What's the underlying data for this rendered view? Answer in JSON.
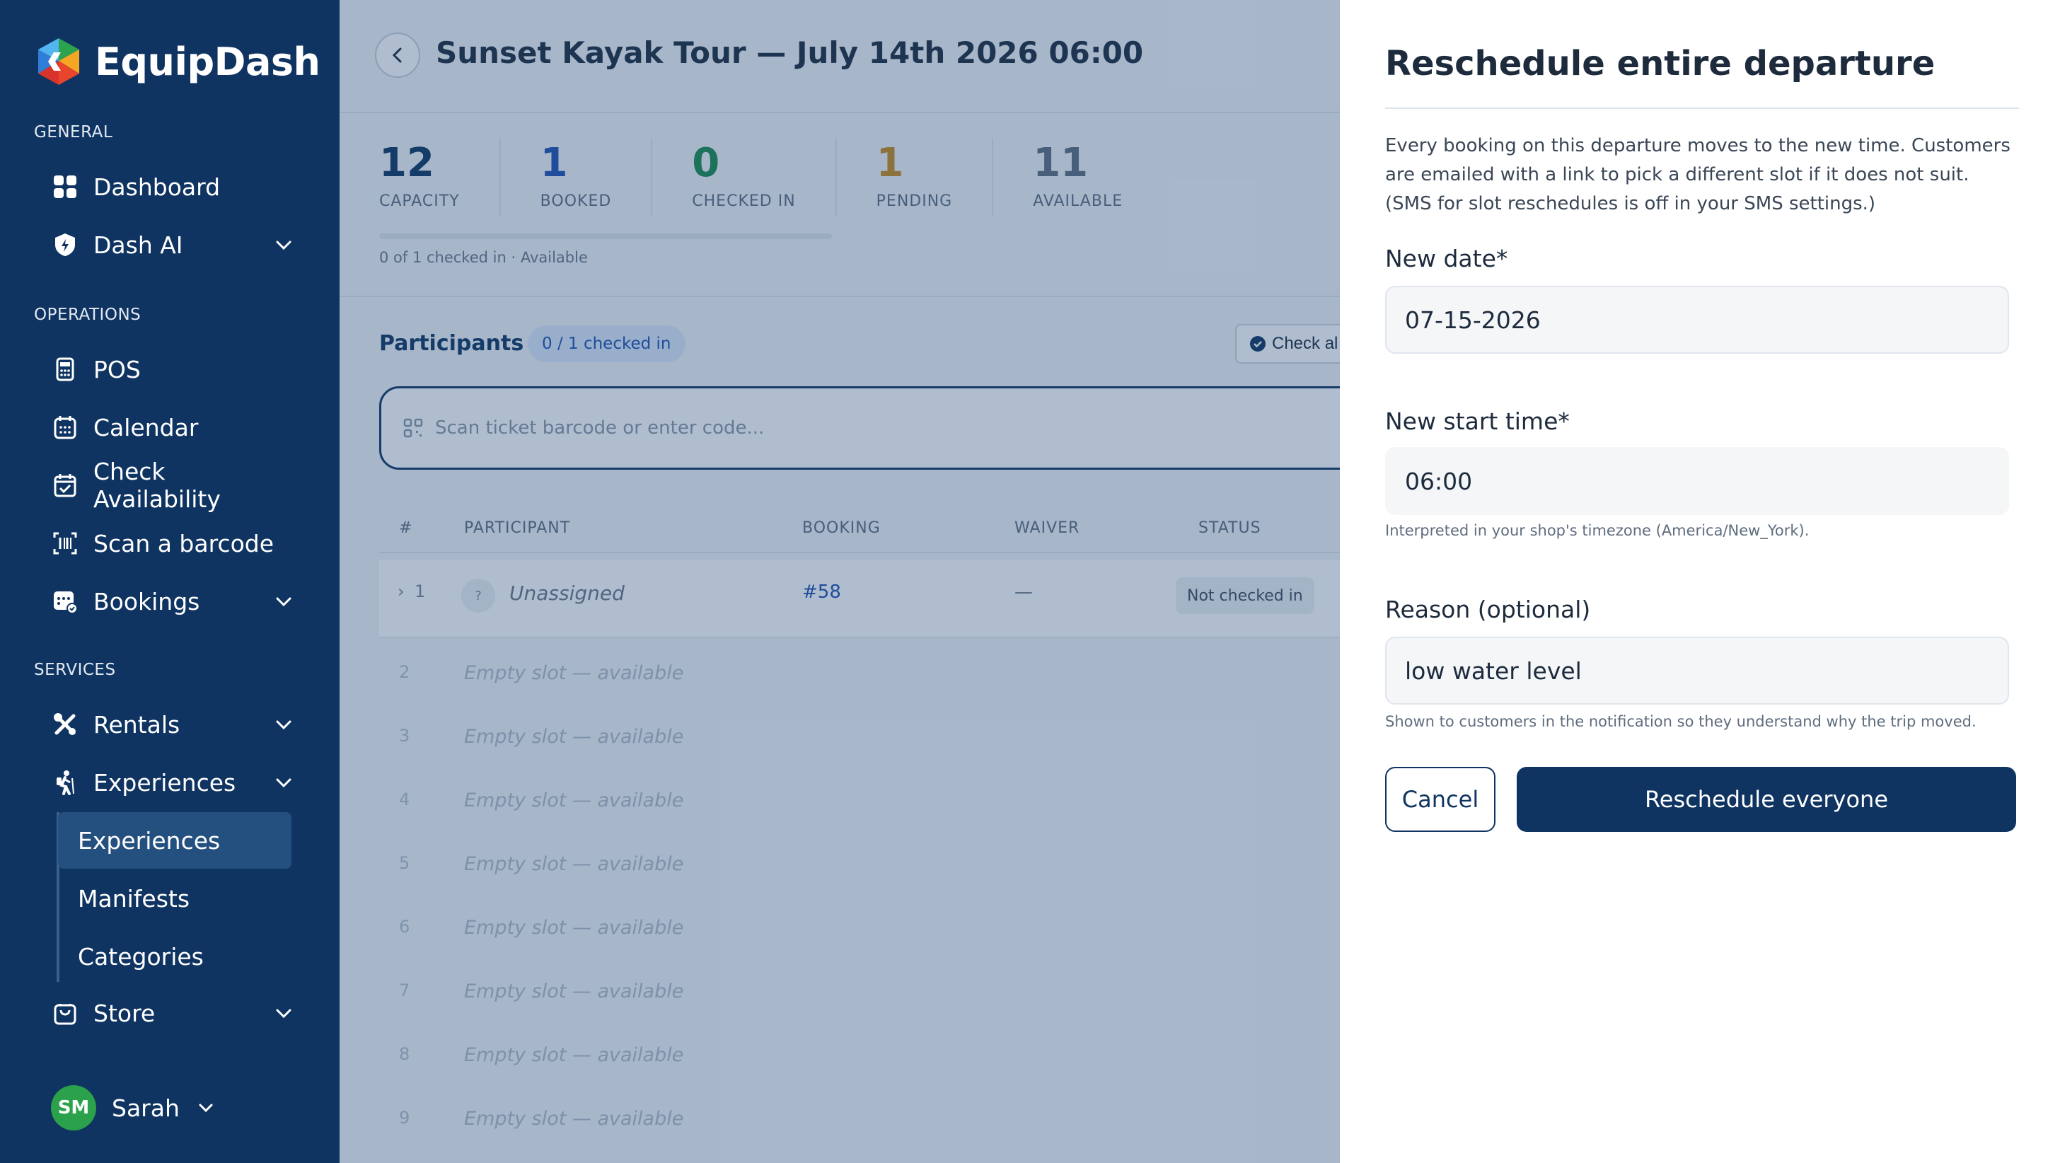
{
  "sidebar": {
    "brand": "EquipDash",
    "sections": {
      "general": "GENERAL",
      "operations": "OPERATIONS",
      "services": "SERVICES"
    },
    "items": {
      "dashboard": "Dashboard",
      "dash_ai": "Dash AI",
      "pos": "POS",
      "calendar": "Calendar",
      "check_availability": "Check Availability",
      "scan_barcode": "Scan a barcode",
      "bookings": "Bookings",
      "rentals": "Rentals",
      "experiences": "Experiences",
      "store": "Store"
    },
    "sub_items": {
      "experiences": "Experiences",
      "manifests": "Manifests",
      "categories": "Categories"
    },
    "user": {
      "initials": "SM",
      "name": "Sarah"
    }
  },
  "header": {
    "title": "Sunset Kayak Tour — July 14th 2026 06:00"
  },
  "stats": [
    {
      "value": "12",
      "label": "CAPACITY",
      "color": "#0f3461"
    },
    {
      "value": "1",
      "label": "BOOKED",
      "color": "#1f4fb0"
    },
    {
      "value": "0",
      "label": "CHECKED IN",
      "color": "#1a8a4a"
    },
    {
      "value": "1",
      "label": "PENDING",
      "color": "#c98a1d"
    },
    {
      "value": "11",
      "label": "AVAILABLE",
      "color": "#5f6d7e"
    }
  ],
  "progress": {
    "checked_fraction": 0,
    "note": "0 of 1 checked in · Available"
  },
  "participants": {
    "title": "Participants",
    "pill": "0 / 1 checked in",
    "check_all": "Check al",
    "scan_placeholder": "Scan ticket barcode or enter code..."
  },
  "table": {
    "headers": {
      "num": "#",
      "participant": "PARTICIPANT",
      "booking": "BOOKING",
      "waiver": "WAIVER",
      "status": "STATUS"
    },
    "first_row": {
      "num": "1",
      "qmark": "?",
      "participant": "Unassigned",
      "booking": "#58",
      "waiver": "—",
      "status": "Not checked in"
    },
    "empty_rows": [
      {
        "num": "2",
        "text": "Empty slot — available"
      },
      {
        "num": "3",
        "text": "Empty slot — available"
      },
      {
        "num": "4",
        "text": "Empty slot — available"
      },
      {
        "num": "5",
        "text": "Empty slot — available"
      },
      {
        "num": "6",
        "text": "Empty slot — available"
      },
      {
        "num": "7",
        "text": "Empty slot — available"
      },
      {
        "num": "8",
        "text": "Empty slot — available"
      },
      {
        "num": "9",
        "text": "Empty slot — available"
      }
    ]
  },
  "drawer": {
    "title": "Reschedule entire departure",
    "description": "Every booking on this departure moves to the new time. Customers are emailed with a link to pick a different slot if it does not suit. (SMS for slot reschedules is off in your SMS settings.)",
    "date_label": "New date*",
    "date_value": "07-15-2026",
    "time_label": "New start time*",
    "time_value": "06:00",
    "time_help": "Interpreted in your shop's timezone (America/New_York).",
    "reason_label": "Reason (optional)",
    "reason_value": "low water level",
    "reason_help": "Shown to customers in the notification so they understand why the trip moved.",
    "cancel": "Cancel",
    "submit": "Reschedule everyone"
  }
}
